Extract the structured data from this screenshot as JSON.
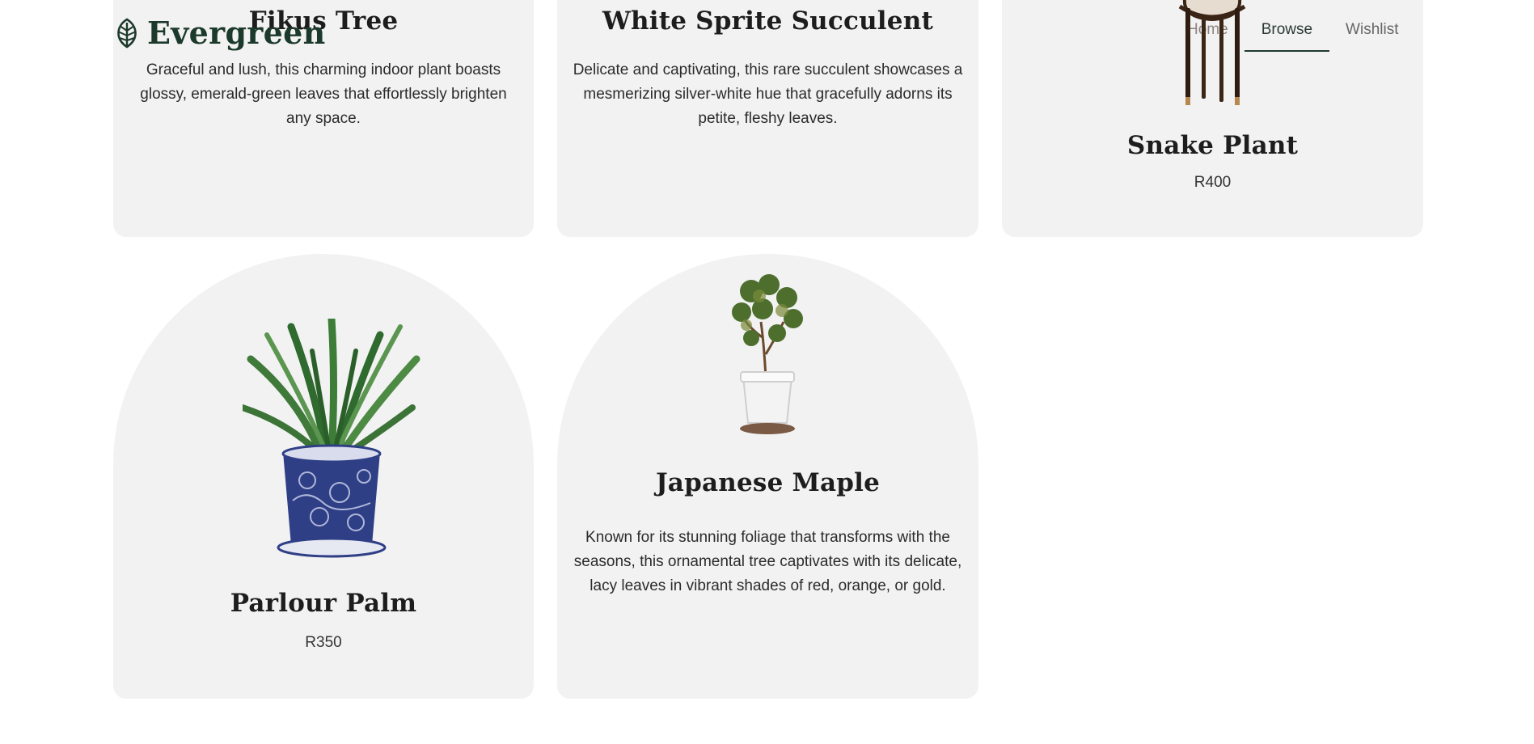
{
  "brand": {
    "name": "Evergreen",
    "logo_icon": "leaf-icon",
    "color": "#1c3a2c"
  },
  "nav": {
    "items": [
      {
        "label": "Home",
        "active": false
      },
      {
        "label": "Browse",
        "active": true
      },
      {
        "label": "Wishlist",
        "active": false
      }
    ]
  },
  "products": [
    {
      "title": "Fikus Tree",
      "description": "Graceful and lush, this charming indoor plant boasts glossy, emerald-green leaves that effortlessly brighten any space."
    },
    {
      "title": "White Sprite Succulent",
      "description": "Delicate and captivating, this rare succulent showcases a mesmerizing silver-white hue that gracefully adorns its petite, fleshy leaves."
    },
    {
      "title": "Snake Plant",
      "price": "R400",
      "image_icon": "plant-stand-image"
    },
    {
      "title": "Parlour Palm",
      "price": "R350",
      "image_icon": "parlour-palm-image"
    },
    {
      "title": "Japanese Maple",
      "description": "Known for its stunning foliage that transforms with the seasons, this ornamental tree captivates with its delicate, lacy leaves in vibrant shades of red, orange, or gold.",
      "image_icon": "japanese-maple-image"
    }
  ],
  "colors": {
    "card_background": "#f2f2f2",
    "accent": "#1f3b2e",
    "page_background": "#ffffff"
  }
}
